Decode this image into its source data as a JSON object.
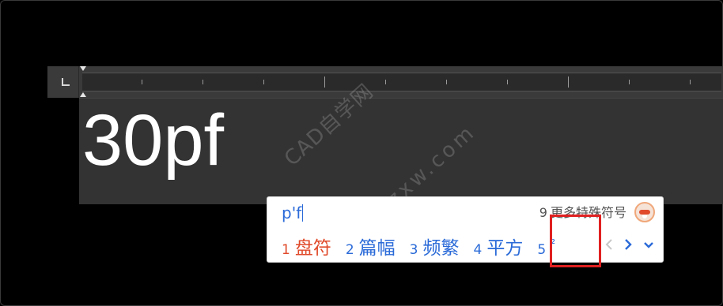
{
  "editor": {
    "text": "30pf"
  },
  "watermark": {
    "line1": "CAD自学网",
    "line2": "cadzxw.com"
  },
  "ime": {
    "input": "p'f",
    "more_index": "9",
    "more_label": "更多特殊符号",
    "candidates": [
      {
        "index": "1",
        "text": "盘符"
      },
      {
        "index": "2",
        "text": "篇幅"
      },
      {
        "index": "3",
        "text": "频繁"
      },
      {
        "index": "4",
        "text": "平方"
      },
      {
        "index": "5",
        "text": "²"
      }
    ],
    "icons": {
      "prev": "chevron-left-icon",
      "next": "chevron-right-icon",
      "expand": "chevron-down-icon",
      "mascot": "ime-mascot-icon"
    }
  },
  "colors": {
    "background": "#000000",
    "editor": "#333333",
    "ruler": "#3a3a3a",
    "candidate": "#2a6ad8",
    "first_candidate": "#e04a2a",
    "highlight": "#e02020"
  }
}
